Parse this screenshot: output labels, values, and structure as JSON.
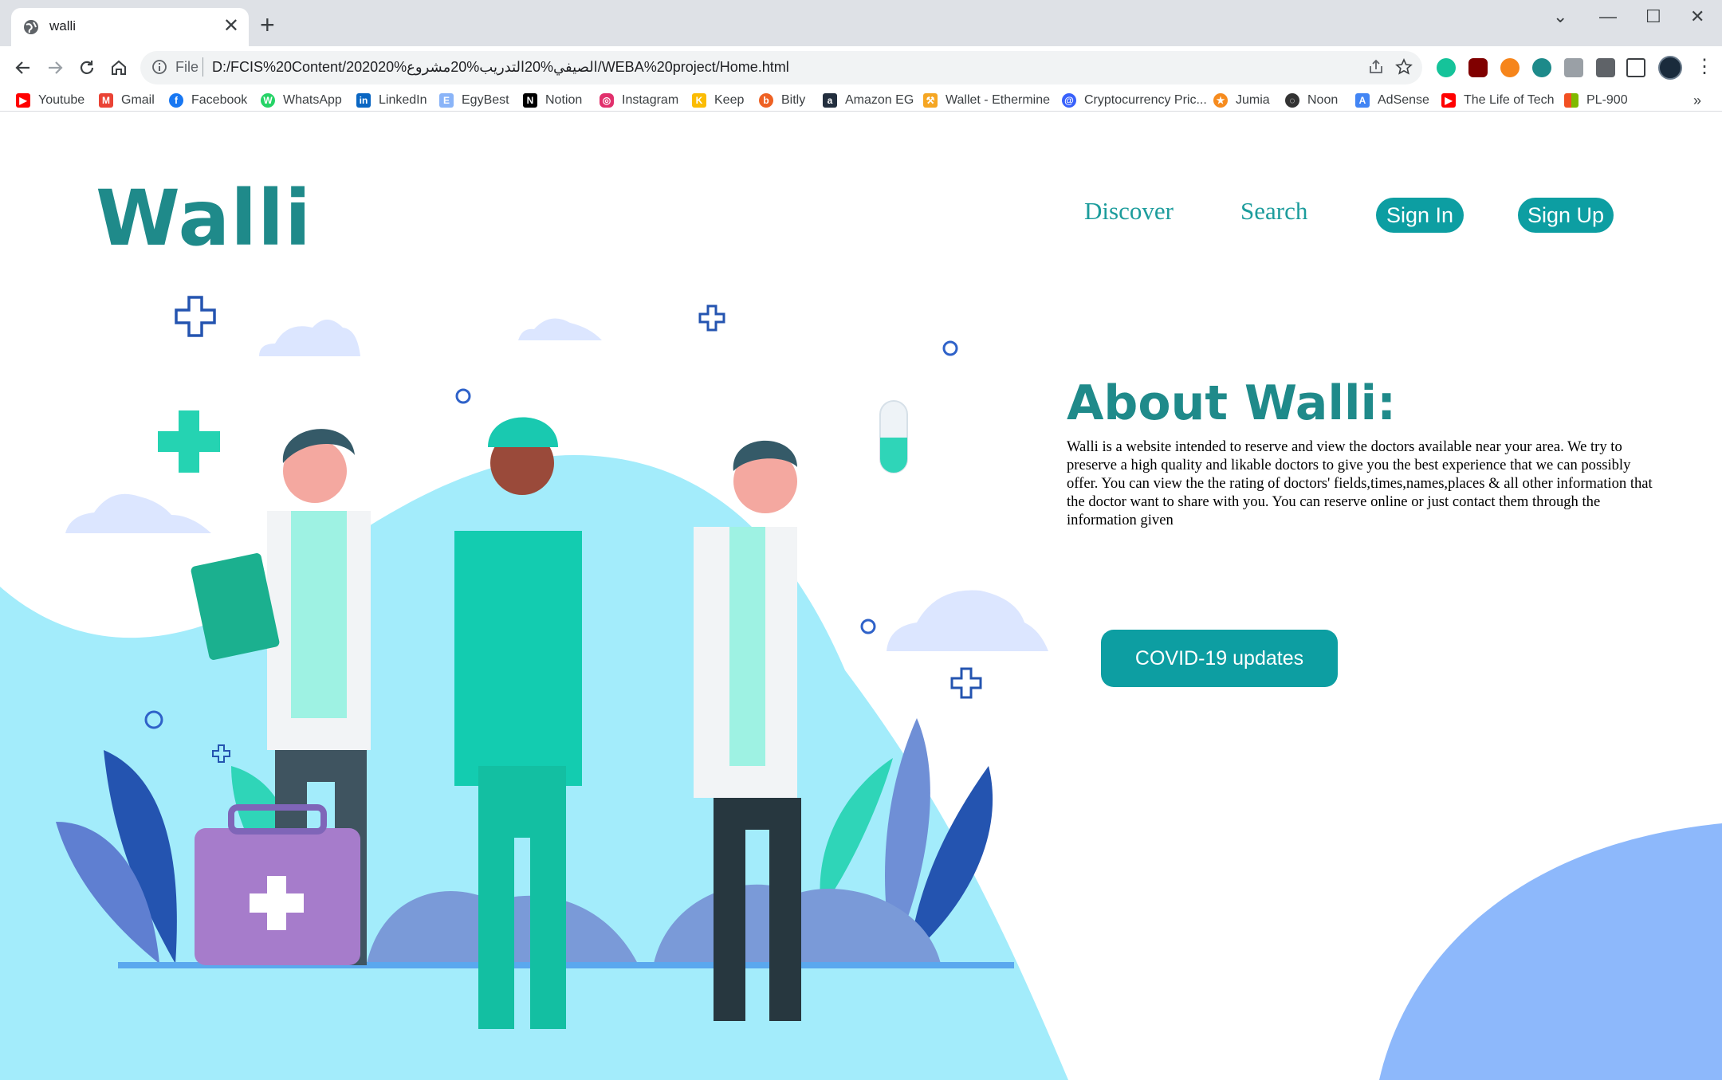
{
  "browser": {
    "tab": {
      "title": "walli"
    },
    "address": {
      "scheme_label": "File",
      "url": "D:/FCIS%20Content/202020%الصيفي%20التدريب%20مشروع/WEBA%20project/Home.html"
    },
    "bookmarks": [
      {
        "label": "Youtube",
        "color": "#ff0000"
      },
      {
        "label": "Gmail",
        "color": "#ea4335"
      },
      {
        "label": "Facebook",
        "color": "#1877f2"
      },
      {
        "label": "WhatsApp",
        "color": "#25d366"
      },
      {
        "label": "LinkedIn",
        "color": "#0a66c2"
      },
      {
        "label": "EgyBest",
        "color": "#8ab4f8"
      },
      {
        "label": "Notion",
        "color": "#000000"
      },
      {
        "label": "Instagram",
        "color": "#e1306c"
      },
      {
        "label": "Keep",
        "color": "#fbbc04"
      },
      {
        "label": "Bitly",
        "color": "#ee6123"
      },
      {
        "label": "Amazon EG",
        "color": "#232f3e"
      },
      {
        "label": "Wallet - Ethermine",
        "color": "#f5a623"
      },
      {
        "label": "Cryptocurrency Pric...",
        "color": "#3861fb"
      },
      {
        "label": "Jumia",
        "color": "#f68b1e"
      },
      {
        "label": "Noon",
        "color": "#333333"
      },
      {
        "label": "AdSense",
        "color": "#4285f4"
      },
      {
        "label": "The Life of Tech",
        "color": "#ff0000"
      },
      {
        "label": "PL-900",
        "color": "#f25022"
      }
    ],
    "more_bookmarks": "»"
  },
  "site": {
    "logo": "Walli",
    "nav": {
      "discover": "Discover",
      "search": "Search",
      "sign_in": "Sign In",
      "sign_up": "Sign Up"
    },
    "about": {
      "title": "About Walli:",
      "body": "Walli is a website intended to reserve and view the doctors available near your area. We try to preserve a high quality and likable doctors to give you the best experience that we can possibly offer. You can view the the rating of doctors' fields,times,names,places & all other information that the doctor want to share with you. You can reserve online or just contact them through the information given"
    },
    "cta": "COVID-19 updates"
  },
  "colors": {
    "brand_teal": "#1f8a8a",
    "button_teal": "#0d9ea2",
    "hero_blue": "#a3ecfb",
    "corner_blue": "#8db8fb"
  }
}
